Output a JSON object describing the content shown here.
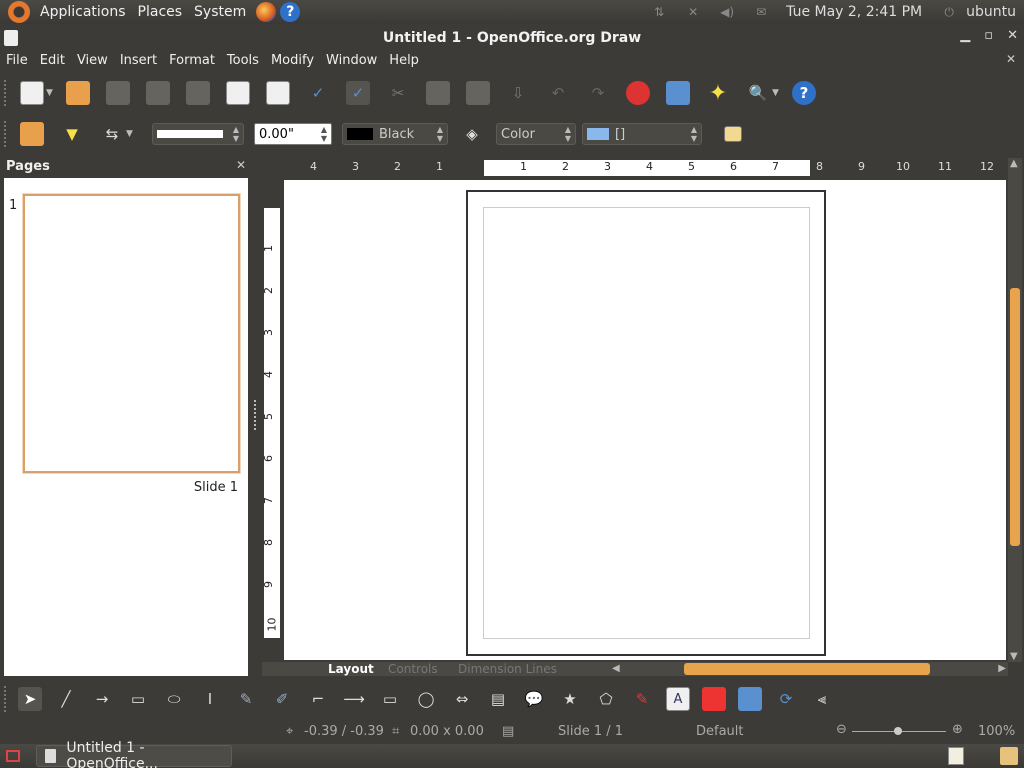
{
  "top_panel": {
    "menus": [
      "Applications",
      "Places",
      "System"
    ],
    "clock": "Tue May  2,  2:41 PM",
    "user": "ubuntu"
  },
  "window": {
    "title": "Untitled 1 - OpenOffice.org Draw"
  },
  "menubar": {
    "items": [
      "File",
      "Edit",
      "View",
      "Insert",
      "Format",
      "Tools",
      "Modify",
      "Window",
      "Help"
    ]
  },
  "format_toolbar": {
    "line_width": "0.00\"",
    "line_color": "Black",
    "area_style": "Color",
    "area_value": "[]"
  },
  "pages_pane": {
    "title": "Pages",
    "slide_number": "1",
    "slide_label": "Slide 1"
  },
  "ruler": {
    "h_left": [
      "4",
      "3",
      "2",
      "1"
    ],
    "h_right": [
      "1",
      "2",
      "3",
      "4",
      "5",
      "6",
      "7"
    ],
    "h_tail": [
      "8",
      "9",
      "10",
      "11",
      "12"
    ],
    "v": [
      "1",
      "2",
      "3",
      "4",
      "5",
      "6",
      "7",
      "8",
      "9",
      "10"
    ]
  },
  "layer_tabs": [
    "Layout",
    "Controls",
    "Dimension Lines"
  ],
  "statusbar": {
    "position": "-0.39 / -0.39",
    "size": "0.00 x 0.00",
    "slide": "Slide 1 / 1",
    "master": "Default",
    "zoom": "100%"
  },
  "taskbar": {
    "window_label": "Untitled 1 - OpenOffice..."
  },
  "colors": {
    "accent": "#e8a34d",
    "panel": "#3c3b37",
    "line_swatch": "#000000",
    "area_swatch": "#8ab8ec"
  }
}
